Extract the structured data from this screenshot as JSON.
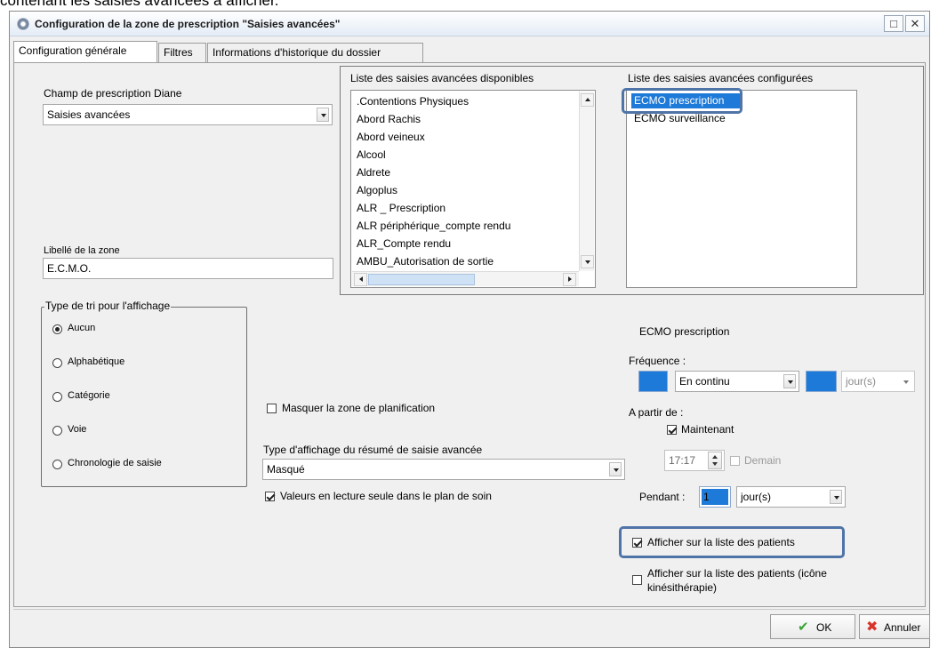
{
  "caption": "contenant les saisies avancées à afficher.",
  "window": {
    "title": "Configuration de la zone de prescription \"Saisies avancées\"",
    "maximize_glyph": "□",
    "close_glyph": "✕"
  },
  "tabs": [
    "Configuration générale",
    "Filtres",
    "Informations d'historique du dossier"
  ],
  "left": {
    "champ_label": "Champ de prescription Diane",
    "champ_value": "Saisies avancées",
    "libelle_label": "Libellé de la zone",
    "libelle_value": "E.C.M.O.",
    "tri_title": "Type de tri pour l'affichage",
    "tri_options": [
      "Aucun",
      "Alphabétique",
      "Catégorie",
      "Voie",
      "Chronologie de saisie"
    ],
    "tri_selected": "Aucun"
  },
  "available": {
    "title": "Liste des saisies avancées disponibles",
    "items": [
      ".Contentions Physiques",
      "Abord Rachis",
      "Abord veineux",
      "Alcool",
      "Aldrete",
      "Algoplus",
      "ALR _ Prescription",
      "ALR périphérique_compte rendu",
      "ALR_Compte rendu",
      "AMBU_Autorisation de sortie"
    ]
  },
  "configured": {
    "title": "Liste des saisies avancées configurées",
    "items": [
      "ECMO prescription",
      "ECMO surveillance"
    ],
    "selected": "ECMO prescription"
  },
  "middle": {
    "masquer_label": "Masquer la zone de planification",
    "masquer_checked": false,
    "type_affichage_label": "Type d'affichage du résumé de saisie avancée",
    "type_affichage_value": "Masqué",
    "lecture_seule_label": "Valeurs en lecture seule dans le plan de soin",
    "lecture_seule_checked": true
  },
  "detail": {
    "title": "ECMO prescription",
    "frequence_label": "Fréquence :",
    "frequence_value": "En continu",
    "frequence_unit": "jour(s)",
    "a_partir_label": "A partir de :",
    "maintenant_label": "Maintenant",
    "maintenant_checked": true,
    "time_value": "17:17",
    "demain_label": "Demain",
    "demain_checked": false,
    "pendant_label": "Pendant :",
    "pendant_value": "1",
    "pendant_unit": "jour(s)",
    "afficher_label": "Afficher sur la liste des patients",
    "afficher_checked": true,
    "afficher_kine_label": "Afficher sur la liste des patients (icône kinésithérapie)",
    "afficher_kine_checked": false
  },
  "footer": {
    "ok_label": "OK",
    "cancel_label": "Annuler"
  },
  "colors": {
    "accent_blue": "#1e7ad8",
    "highlight_border": "#4f74a8",
    "ok_check": "#3aa335",
    "cancel_x": "#d8342b"
  }
}
